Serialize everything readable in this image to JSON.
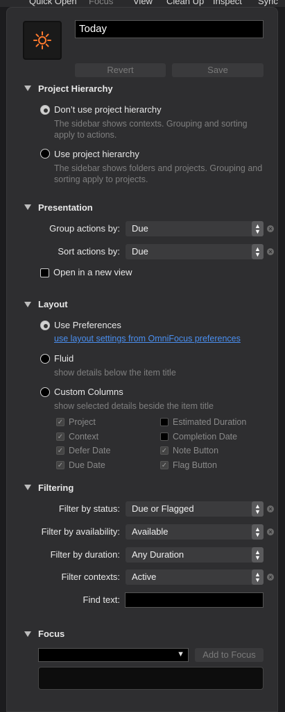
{
  "toolbar": {
    "quick_open": "Quick Open",
    "focus": "Focus",
    "view": "View",
    "clean_up": "Clean Up",
    "inspect": "Inspect",
    "sync": "Sync"
  },
  "perspective": {
    "name": "Today",
    "revert": "Revert",
    "save": "Save",
    "icon": "sun-icon",
    "icon_color": "#ff7a2e"
  },
  "project_hierarchy": {
    "title": "Project Hierarchy",
    "opt1": "Don’t use project hierarchy",
    "opt1_desc": "The sidebar shows contexts. Grouping and sorting apply to actions.",
    "opt2": "Use project hierarchy",
    "opt2_desc": "The sidebar shows folders and projects. Grouping and sorting apply to projects."
  },
  "presentation": {
    "title": "Presentation",
    "group_label": "Group actions by:",
    "group_value": "Due",
    "sort_label": "Sort actions by:",
    "sort_value": "Due",
    "new_view": "Open in a new view"
  },
  "layout": {
    "title": "Layout",
    "prefs": "Use Preferences",
    "prefs_link": "use layout settings from OmniFocus preferences",
    "fluid": "Fluid",
    "fluid_desc": "show details below the item title",
    "custom": "Custom Columns",
    "custom_desc": "show selected details beside the item title",
    "col_left": [
      "Project",
      "Context",
      "Defer Date",
      "Due Date"
    ],
    "col_right": [
      "Estimated Duration",
      "Completion Date",
      "Note Button",
      "Flag Button"
    ]
  },
  "filtering": {
    "title": "Filtering",
    "status_label": "Filter by status:",
    "status_value": "Due or Flagged",
    "availability_label": "Filter by availability:",
    "availability_value": "Available",
    "duration_label": "Filter by duration:",
    "duration_value": "Any Duration",
    "contexts_label": "Filter contexts:",
    "contexts_value": "Active",
    "find_label": "Find text:",
    "find_value": ""
  },
  "focus": {
    "title": "Focus",
    "add_button": "Add to Focus",
    "selected": ""
  }
}
